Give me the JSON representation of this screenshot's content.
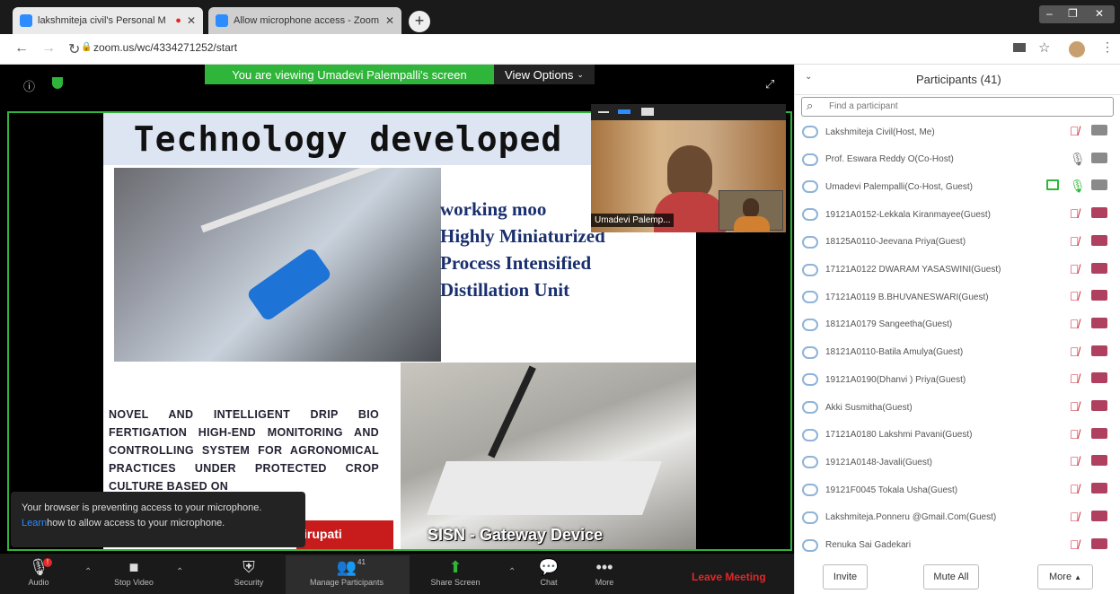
{
  "browser": {
    "tabs": [
      {
        "title": "lakshmiteja civil's Personal M",
        "recording": true
      },
      {
        "title": "Allow microphone access - Zoom"
      }
    ],
    "url": "zoom.us/wc/4334271252/start"
  },
  "meeting": {
    "banner": "You are viewing Umadevi Palempalli's screen",
    "view_options": "View Options",
    "slide": {
      "title": "Technology developed",
      "right_text": [
        "working moo",
        "Highly Miniaturized",
        "Process Intensified",
        "Distillation Unit"
      ],
      "left_text": "NOVEL AND INTELLIGENT DRIP BIO FERTIGATION HIGH-END MONITORING AND CONTROLLING SYSTEM FOR AGRONOMICAL PRACTICES UNDER PROTECTED CROP CULTURE BASED ON",
      "caption": "SISN - Gateway Device",
      "footer": "irupati"
    },
    "video_name": "Umadevi Palemp...",
    "toast": {
      "line1": "Your browser is preventing access to your microphone.",
      "link": "Learn",
      "line2": "how to allow access to your microphone."
    },
    "toolbar": {
      "audio": "Audio",
      "video": "Stop Video",
      "security": "Security",
      "manage": "Manage Participants",
      "participants_count": "41",
      "share": "Share Screen",
      "chat": "Chat",
      "more": "More",
      "leave": "Leave Meeting",
      "audio_badge": "!"
    }
  },
  "panel": {
    "title": "Participants (41)",
    "search_placeholder": "Find a participant",
    "participants": [
      {
        "name": "Lakshmiteja Civil(Host, Me)"
      },
      {
        "name": "Prof. Eswara Reddy O(Co-Host)"
      },
      {
        "name": "Umadevi Palempalli(Co-Host, Guest)"
      },
      {
        "name": "19121A0152-Lekkala Kiranmayee(Guest)"
      },
      {
        "name": "18125A0110-Jeevana Priya(Guest)"
      },
      {
        "name": "17121A0122 DWARAM YASASWINI(Guest)"
      },
      {
        "name": "17121A0119 B.BHUVANESWARI(Guest)"
      },
      {
        "name": "18121A0179 Sangeetha(Guest)"
      },
      {
        "name": "18121A0110-Batila Amulya(Guest)"
      },
      {
        "name": "19121A0190(Dhanvi ) Priya(Guest)"
      },
      {
        "name": "Akki Susmitha(Guest)"
      },
      {
        "name": "17121A0180 Lakshmi Pavani(Guest)"
      },
      {
        "name": "19121A0148-Javali(Guest)"
      },
      {
        "name": "19121F0045 Tokala Usha(Guest)"
      },
      {
        "name": "Lakshmiteja.Ponneru @Gmail.Com(Guest)"
      },
      {
        "name": "Renuka Sai Gadekari"
      }
    ],
    "buttons": {
      "invite": "Invite",
      "mute_all": "Mute All",
      "more": "More"
    }
  }
}
